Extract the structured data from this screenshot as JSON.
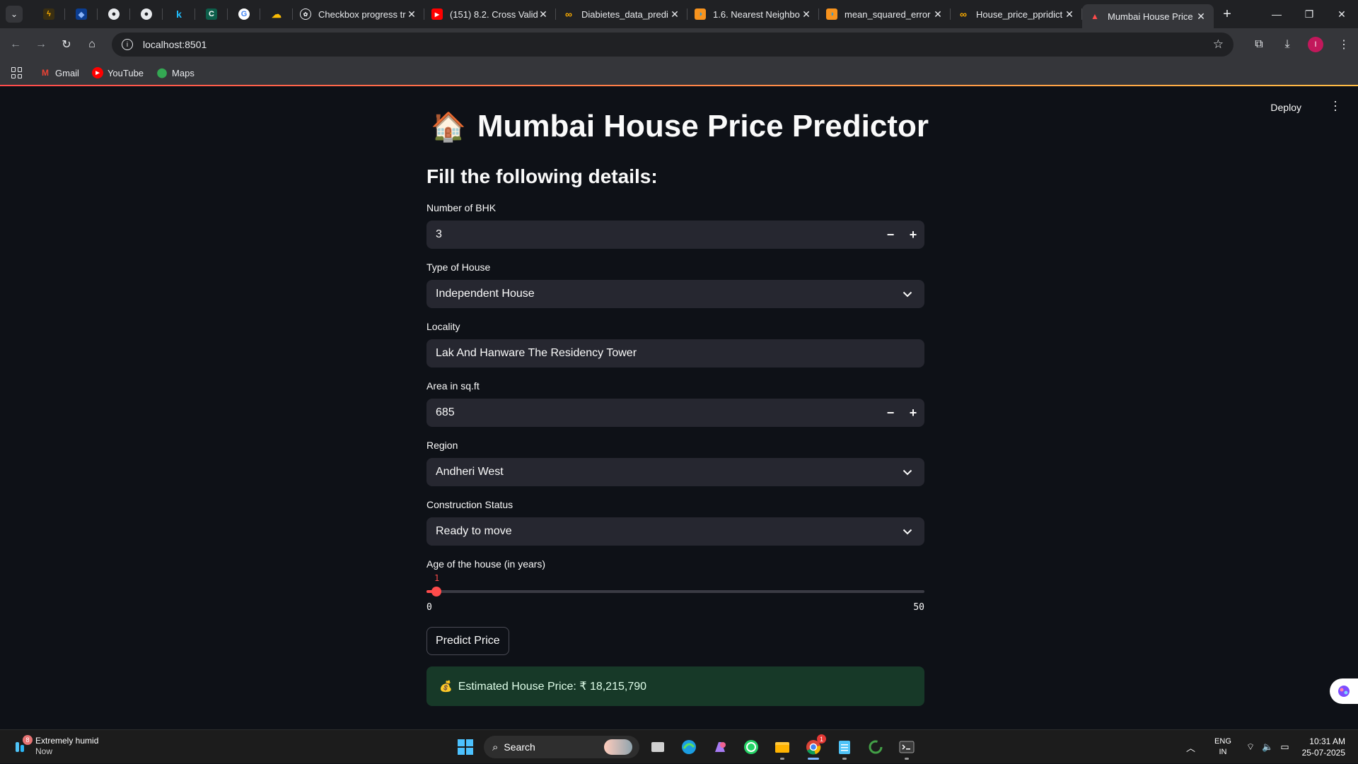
{
  "browser": {
    "tabs": [
      {
        "title": "Checkbox progress tr",
        "icon": "openai-icon",
        "color": "#e8eaed"
      },
      {
        "title": "(151) 8.2. Cross Valid",
        "icon": "youtube-icon",
        "color": "#ff0000"
      },
      {
        "title": "Diabietes_data_predi",
        "icon": "colab-icon",
        "color": "#f9ab00"
      },
      {
        "title": "1.6. Nearest Neighbo",
        "icon": "scikit-icon",
        "color": "#f7931e"
      },
      {
        "title": "mean_squared_error",
        "icon": "scikit-icon",
        "color": "#f7931e"
      },
      {
        "title": "House_price_ppridict",
        "icon": "colab-icon",
        "color": "#f9ab00"
      },
      {
        "title": "Mumbai House Price",
        "icon": "streamlit-icon",
        "color": "#ff4b4b"
      }
    ],
    "url": "localhost:8501",
    "bookmarks": [
      {
        "label": "Gmail",
        "icon": "gmail-icon",
        "color": "#ea4335"
      },
      {
        "label": "YouTube",
        "icon": "youtube-icon",
        "color": "#ff0000"
      },
      {
        "label": "Maps",
        "icon": "maps-icon",
        "color": "#34a853"
      }
    ]
  },
  "app": {
    "deploy_label": "Deploy",
    "title_emoji": "🏠",
    "title": "Mumbai House Price Predictor",
    "subheader": "Fill the following details:",
    "fields": {
      "bhk": {
        "label": "Number of BHK",
        "value": "3"
      },
      "house_type": {
        "label": "Type of House",
        "value": "Independent House"
      },
      "locality": {
        "label": "Locality",
        "value": "Lak And Hanware The Residency Tower"
      },
      "area": {
        "label": "Area in sq.ft",
        "value": "685"
      },
      "region": {
        "label": "Region",
        "value": "Andheri West"
      },
      "status": {
        "label": "Construction Status",
        "value": "Ready to move"
      },
      "age": {
        "label": "Age of the house (in years)",
        "value": 1,
        "min": 0,
        "max": 50
      }
    },
    "stepper": {
      "minus": "−",
      "plus": "+"
    },
    "predict_button": "Predict Price",
    "result": {
      "icon": "money-bag-icon",
      "text": "Estimated House Price: ₹ 18,215,790"
    },
    "accent_color": "#ff4b4b"
  },
  "taskbar": {
    "weather": {
      "title": "Extremely humid",
      "subtitle": "Now",
      "badge": "8"
    },
    "search_placeholder": "Search",
    "chrome_badge": "1",
    "language": {
      "line1": "ENG",
      "line2": "IN"
    },
    "clock": {
      "time": "10:31 AM",
      "date": "25-07-2025"
    }
  }
}
